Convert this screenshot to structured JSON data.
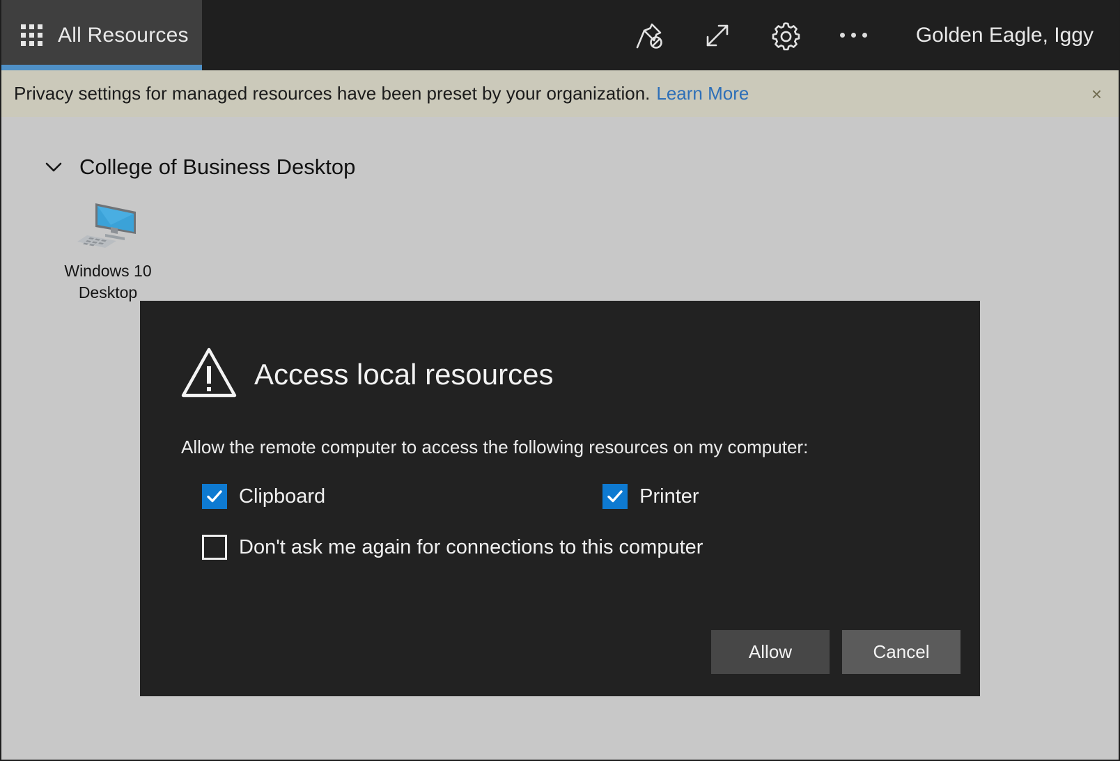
{
  "topbar": {
    "tab": {
      "label": "All Resources",
      "icon": "grid-apps-icon"
    },
    "actions": [
      {
        "name": "unpin-icon",
        "title": "Unpin"
      },
      {
        "name": "expand-icon",
        "title": "Expand"
      },
      {
        "name": "gear-icon",
        "title": "Settings"
      },
      {
        "name": "more-options-icon",
        "title": "More"
      }
    ],
    "user": "Golden Eagle, Iggy",
    "accent_color": "#4f90c6",
    "background_color": "#1f1f1f"
  },
  "banner": {
    "message": "Privacy settings for managed resources have been preset by your organization.",
    "link_label": "Learn More",
    "close_label": "×",
    "background_color": "#cbc9ba",
    "link_color": "#2d6fb8"
  },
  "content": {
    "group": {
      "title": "College of Business Desktop",
      "expanded": true,
      "chevron": "chevron-down-icon"
    },
    "resources": [
      {
        "label": "Windows 10 Desktop",
        "icon": "desktop-computer-icon"
      }
    ],
    "background_color": "#c8c8c8"
  },
  "dialog": {
    "icon": "warning-triangle-icon",
    "title": "Access local resources",
    "body": "Allow the remote computer to access the following resources on my computer:",
    "checkboxes": [
      {
        "label": "Clipboard",
        "checked": true
      },
      {
        "label": "Printer",
        "checked": true
      },
      {
        "label": "Don't ask me again for connections to this computer",
        "checked": false
      }
    ],
    "buttons": {
      "allow": "Allow",
      "cancel": "Cancel"
    },
    "background_color": "#222222",
    "checkbox_color": "#0e7ad1"
  }
}
